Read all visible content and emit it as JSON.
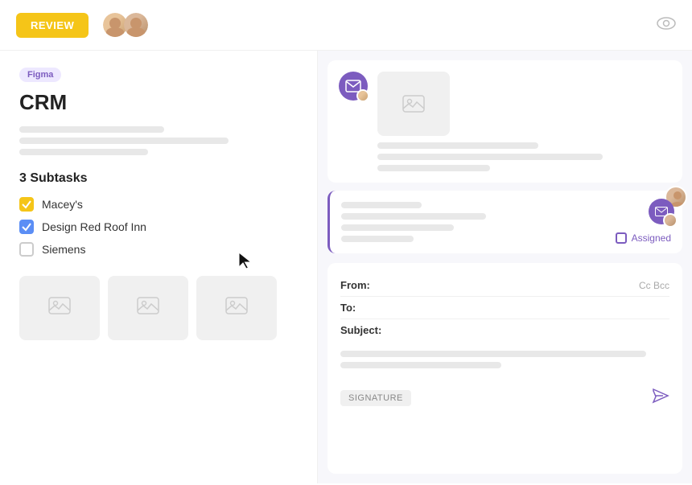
{
  "header": {
    "review_label": "REVIEW",
    "eye_icon": "eye-icon"
  },
  "left_panel": {
    "tag": "Figma",
    "title": "CRM",
    "subtasks_heading": "3 Subtasks",
    "subtasks": [
      {
        "id": 1,
        "label": "Macey's",
        "state": "checked",
        "color": "yellow"
      },
      {
        "id": 2,
        "label": "Design Red Roof Inn",
        "state": "checked",
        "color": "blue"
      },
      {
        "id": 3,
        "label": "Siemens",
        "state": "unchecked",
        "color": "gray"
      }
    ]
  },
  "right_panel": {
    "card1": {
      "email_icon": "email-icon",
      "image_placeholder": "image-icon"
    },
    "card2": {
      "email_icon": "email-icon",
      "assigned_label": "Assigned",
      "user_avatar": "user-avatar"
    },
    "email_compose": {
      "from_label": "From:",
      "to_label": "To:",
      "subject_label": "Subject:",
      "cc_bcc_label": "Cc Bcc",
      "signature_label": "SIGNATURE",
      "send_icon": "send-icon"
    }
  }
}
